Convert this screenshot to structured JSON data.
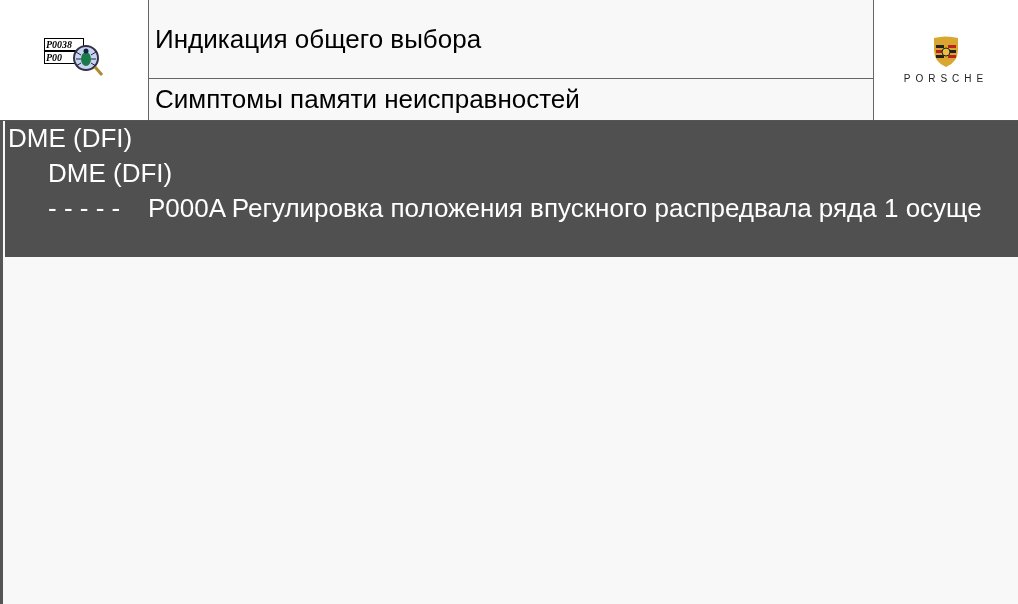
{
  "header": {
    "icon_codes": [
      "P0038",
      "P00"
    ],
    "title": "Индикация общего выбора",
    "subtitle": "Симптомы памяти неисправностей",
    "brand": "PORSCHE"
  },
  "tree": [
    {
      "label": "DME (DFI)",
      "children": [
        {
          "label": "DME (DFI)",
          "children": [
            {
              "status": "- - - - -",
              "label": "P000A Регулировка положения впускного распредвала ряда 1 осуще"
            }
          ]
        }
      ]
    }
  ]
}
